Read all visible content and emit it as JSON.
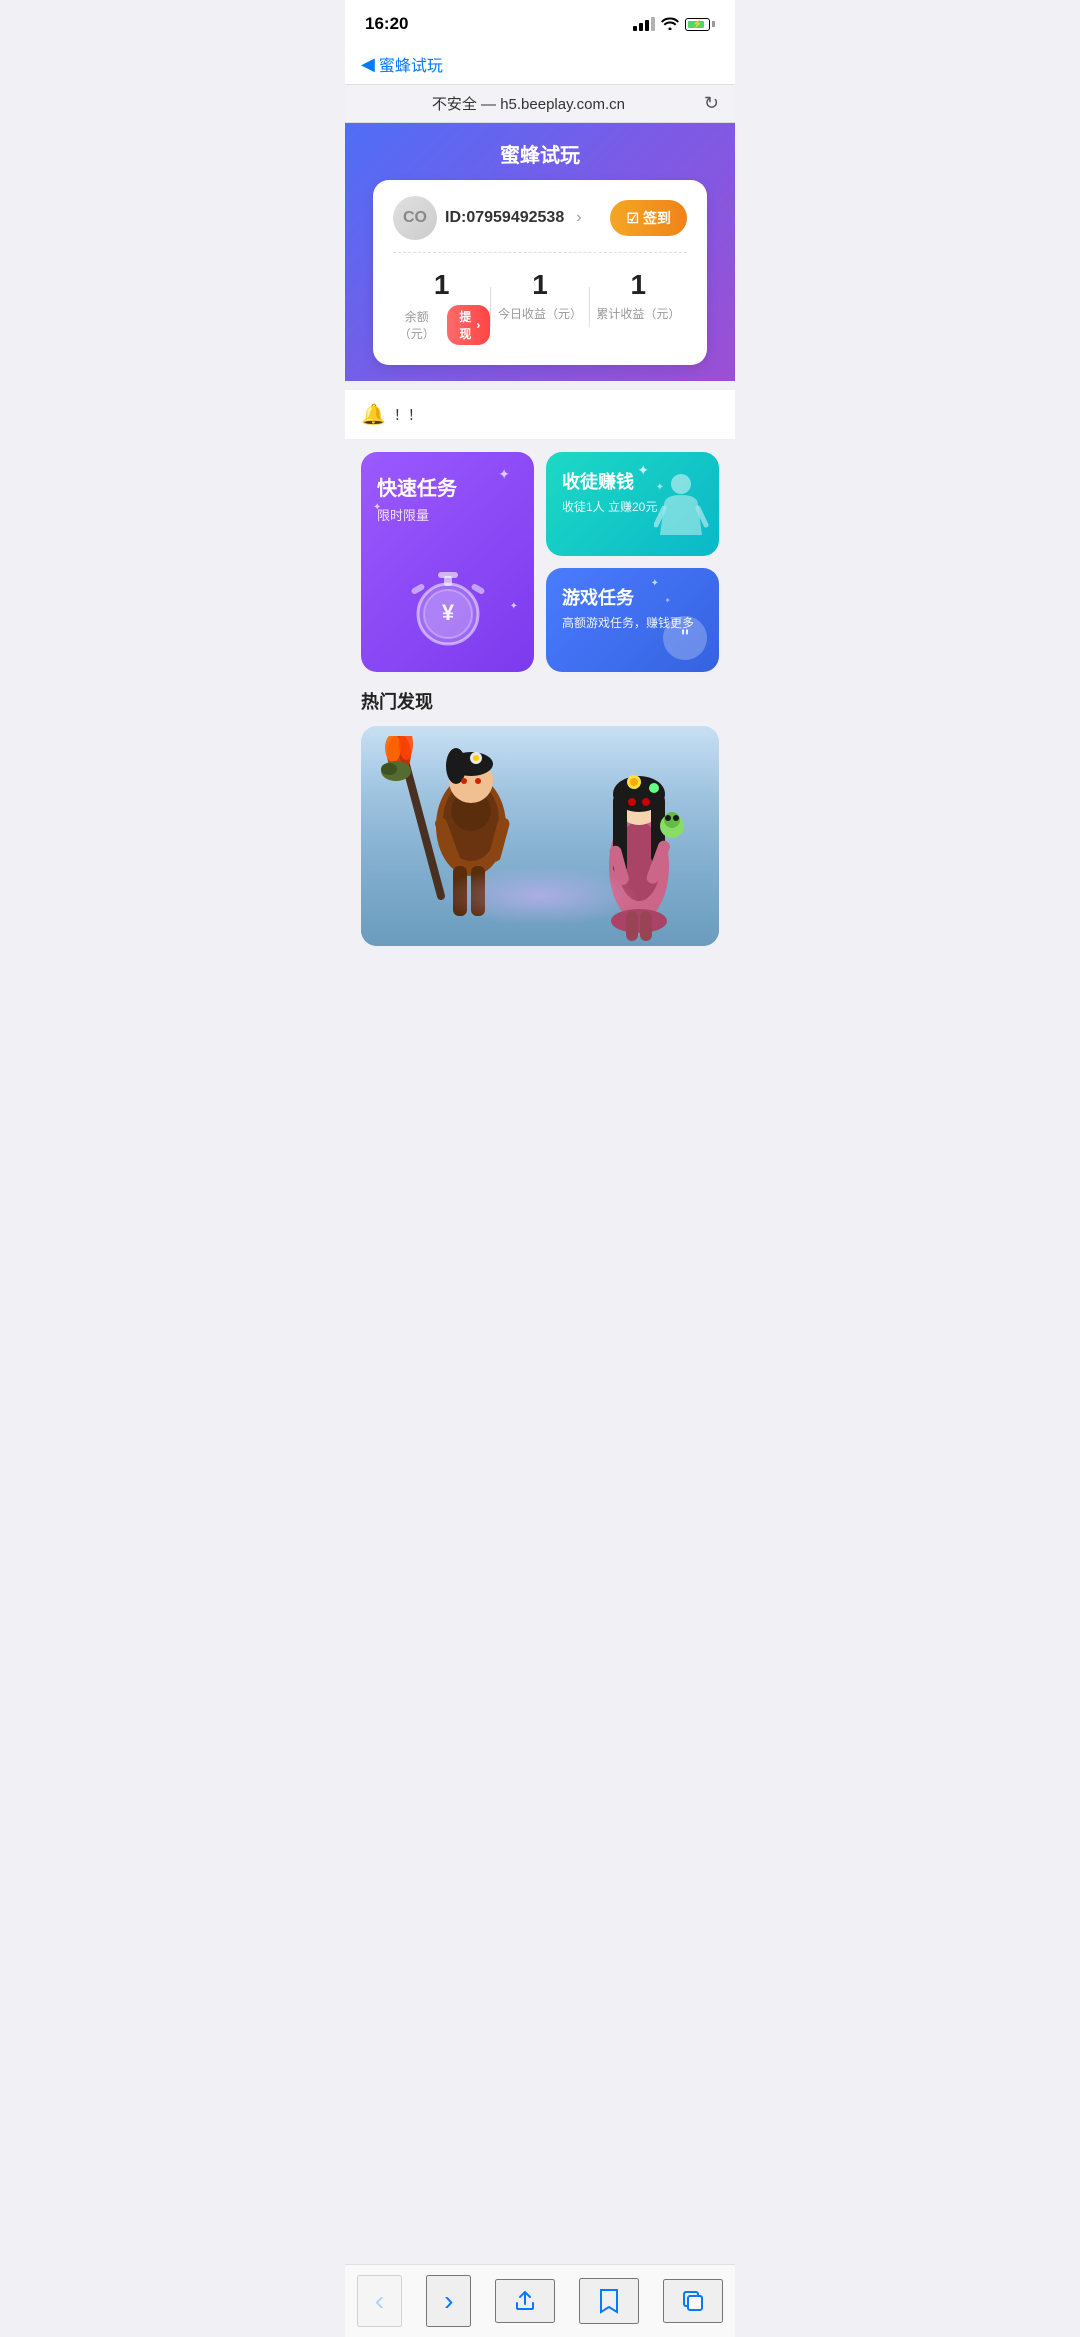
{
  "statusBar": {
    "time": "16:20",
    "timeIcon": "▶"
  },
  "navBar": {
    "backLabel": "蜜蜂试玩",
    "backChevron": "◀"
  },
  "browserBar": {
    "url": "不安全 — h5.beeplay.com.cn",
    "reloadIcon": "↻"
  },
  "header": {
    "title": "蜜蜂试玩"
  },
  "userCard": {
    "avatarText": "CO",
    "userId": "ID:07959492538",
    "userIdArrow": "›",
    "signInLabel": "签到",
    "signInIcon": "☑",
    "balance": "1",
    "balanceLabel": "余额（元）",
    "withdrawLabel": "提现",
    "withdrawArrow": "›",
    "todayEarnings": "1",
    "todayEarningsLabel": "今日收益（元）",
    "totalEarnings": "1",
    "totalEarningsLabel": "累计收益（元）"
  },
  "notification": {
    "bellIcon": "🔔",
    "text": "！！"
  },
  "cards": {
    "left": {
      "title": "快速任务",
      "subtitle": "限时限量"
    },
    "topRight": {
      "title": "收徒赚钱",
      "subtitle": "收徒1人 立赚20元"
    },
    "bottomRight": {
      "title": "游戏任务",
      "subtitle": "高额游戏任务，赚钱更多"
    }
  },
  "hotSection": {
    "title": "热门发现"
  },
  "browserNavButtons": {
    "back": "‹",
    "forward": "›",
    "share": "⬆",
    "bookmarks": "📖",
    "tabs": "⧉"
  }
}
